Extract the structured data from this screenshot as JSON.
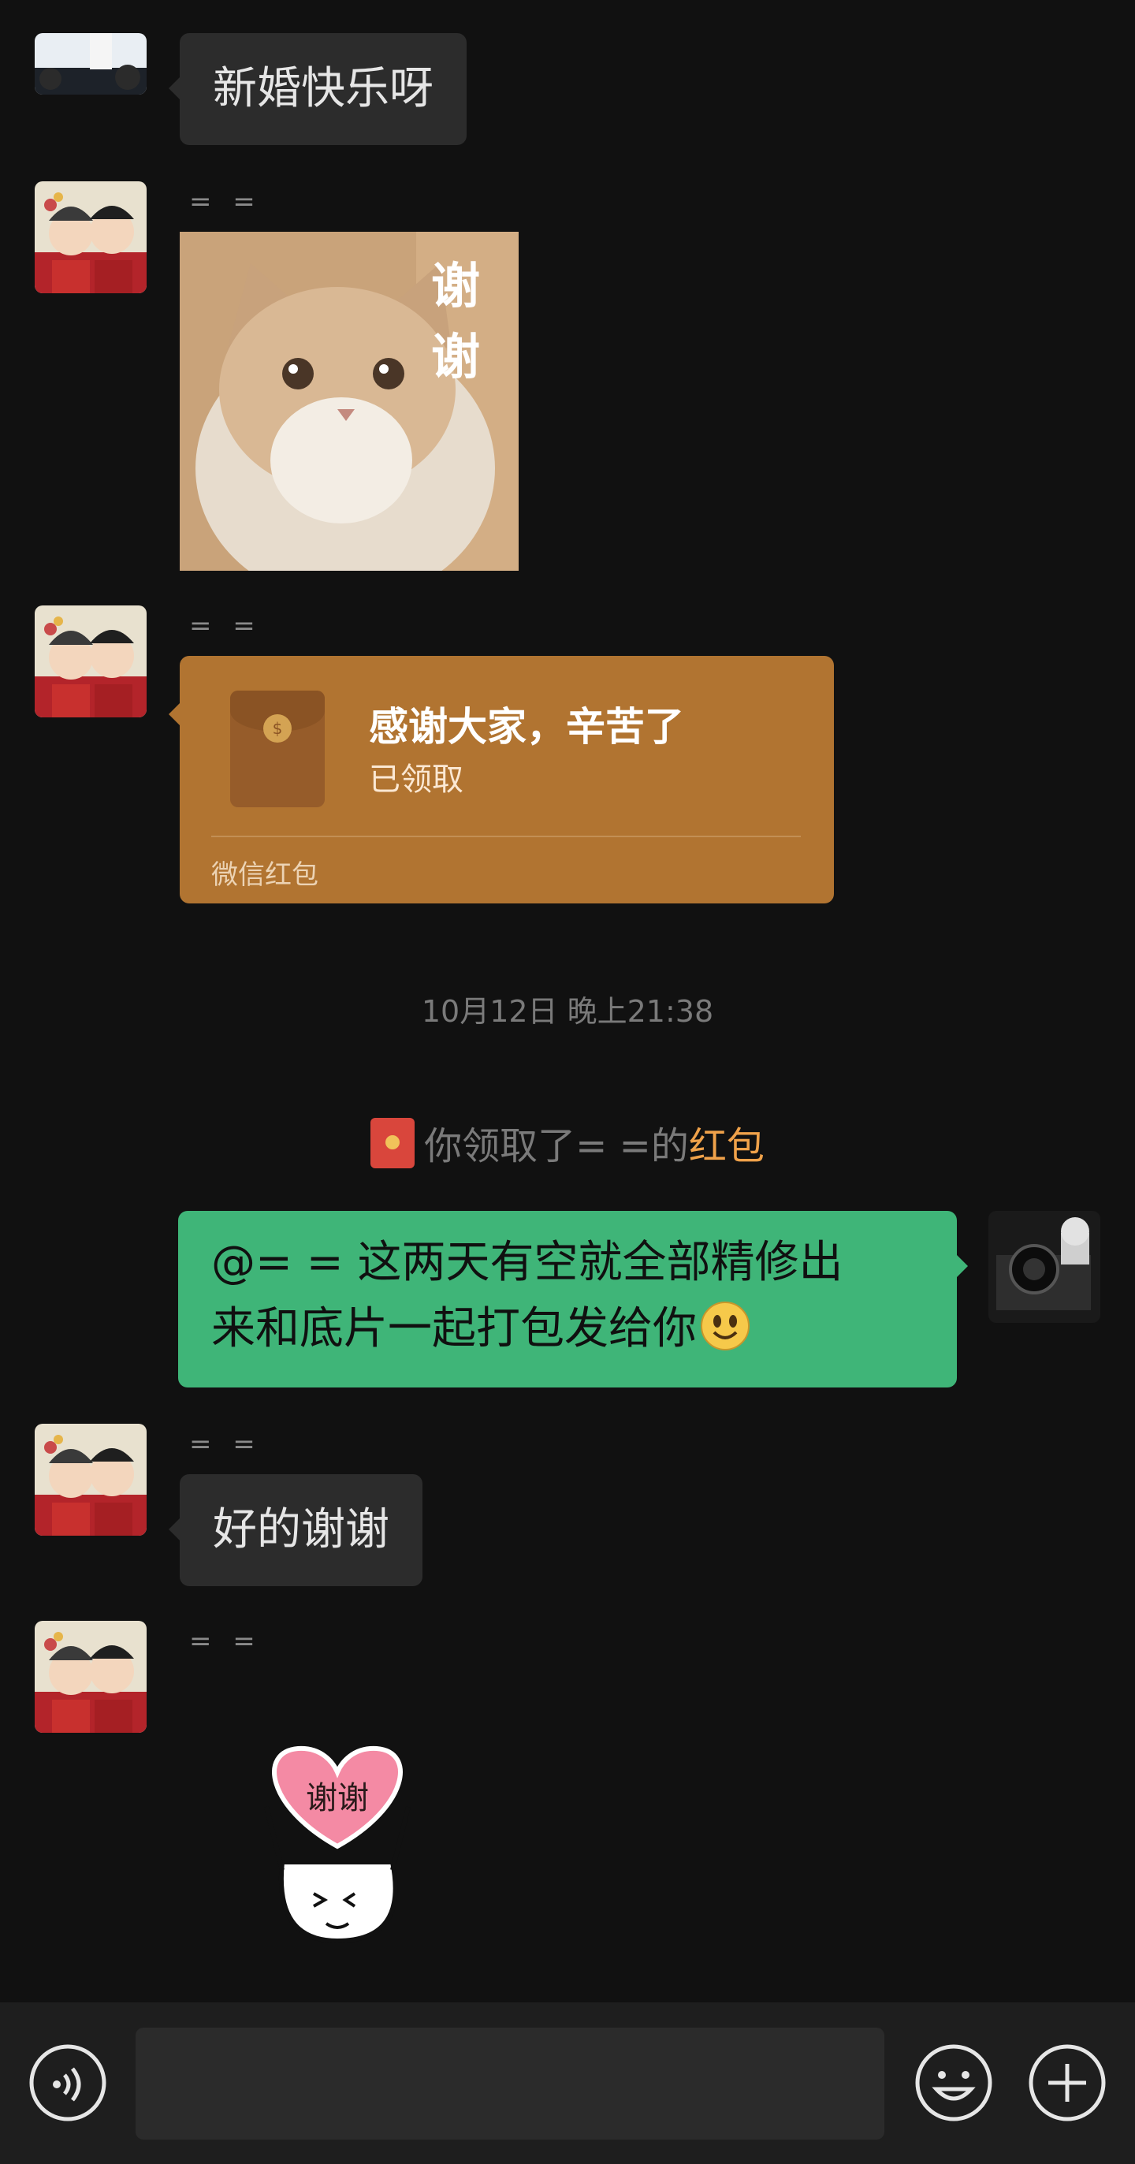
{
  "messages": {
    "m1": {
      "text": "新婚快乐呀"
    },
    "m2": {
      "sender": "= =",
      "sticker_text": "谢谢"
    },
    "m3": {
      "sender": "= =",
      "red_packet": {
        "title": "感谢大家，辛苦了",
        "status": "已领取",
        "footer": "微信红包",
        "coin_glyph": "$"
      }
    },
    "timestamp": "10月12日 晚上21:38",
    "system": {
      "prefix": "你领取了= =的",
      "link": "红包"
    },
    "m4": {
      "text_line1": "@= = 这两天有空就全部精修出",
      "text_line2": "来和底片一起打包发给你"
    },
    "m5": {
      "sender": "= =",
      "text": "好的谢谢"
    },
    "m6": {
      "sender": "= =",
      "sticker_text": "谢谢"
    }
  },
  "input_bar": {
    "voice_icon": "voice-icon",
    "emoji_icon": "emoji-icon",
    "plus_icon": "plus-icon"
  },
  "colors": {
    "background": "#111111",
    "bubble_other": "#2c2c2c",
    "bubble_self": "#3fb578",
    "red_packet": "#b17431",
    "link_orange": "#f0a24a"
  }
}
